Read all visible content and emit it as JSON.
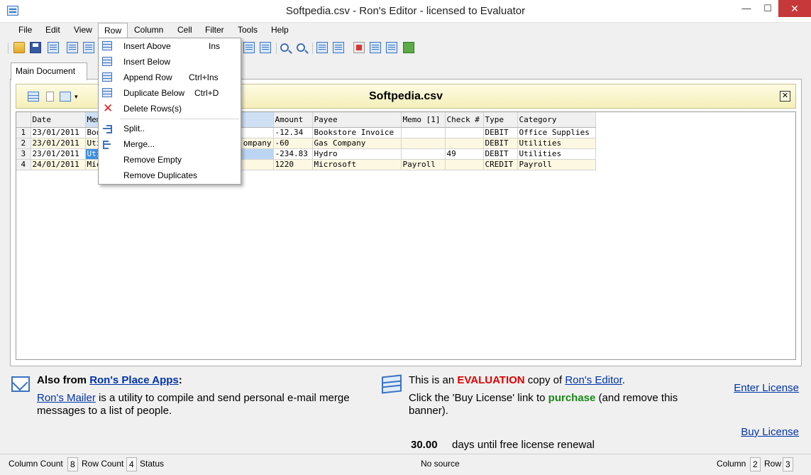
{
  "window": {
    "title": "Softpedia.csv - Ron's Editor - licensed to Evaluator",
    "minimize": "—",
    "maximize": "☐",
    "close": "✕"
  },
  "menubar": [
    "File",
    "Edit",
    "View",
    "Row",
    "Column",
    "Cell",
    "Filter",
    "Tools",
    "Help"
  ],
  "menu_open": "Row",
  "row_menu": [
    {
      "label": "Insert Above",
      "shortcut": "Ins",
      "icon": "insert-above-icon"
    },
    {
      "label": "Insert Below",
      "shortcut": "",
      "icon": "insert-below-icon"
    },
    {
      "label": "Append Row",
      "shortcut": "Ctrl+Ins",
      "icon": "append-row-icon"
    },
    {
      "label": "Duplicate Below",
      "shortcut": "Ctrl+D",
      "icon": "duplicate-icon"
    },
    {
      "label": "Delete Rows(s)",
      "shortcut": "",
      "icon": "delete-icon"
    },
    {
      "label": "Split..",
      "shortcut": "",
      "icon": "split-icon"
    },
    {
      "label": "Merge...",
      "shortcut": "",
      "icon": "merge-icon"
    },
    {
      "label": "Remove Empty",
      "shortcut": "",
      "icon": ""
    },
    {
      "label": "Remove Duplicates",
      "shortcut": "",
      "icon": ""
    }
  ],
  "tab": {
    "label": "Main Document"
  },
  "document": {
    "title": "Softpedia.csv",
    "close": "✕"
  },
  "grid": {
    "columns": [
      "Date",
      "Memo",
      "",
      "Amount",
      "Payee",
      "Memo [1]",
      "Check #",
      "Type",
      "Category"
    ],
    "rows": [
      {
        "n": "1",
        "cells": [
          "23/01/2011",
          "Boo",
          "",
          "-12.34",
          "Bookstore Invoice",
          "",
          "",
          "DEBIT",
          "Office Supplies"
        ]
      },
      {
        "n": "2",
        "cells": [
          "23/01/2011",
          "Uti",
          "ompany",
          "-60",
          "Gas Company",
          "",
          "",
          "DEBIT",
          "Utilities"
        ]
      },
      {
        "n": "3",
        "cells": [
          "23/01/2011",
          "Uti",
          "",
          "-234.83",
          "Hydro",
          "",
          "49",
          "DEBIT",
          "Utilities"
        ]
      },
      {
        "n": "4",
        "cells": [
          "24/01/2011",
          "Mic",
          "",
          "1220",
          "Microsoft",
          "Payroll",
          "",
          "CREDIT",
          "Payroll"
        ]
      }
    ]
  },
  "banner": {
    "also_from": "Also from ",
    "apps_link": "Ron's Place Apps",
    "colon": ":",
    "mailer_link": "Ron's Mailer",
    "mailer_desc": " is a utility to compile and send personal e-mail merge messages to a list of people.",
    "eval_pre": "This is an ",
    "eval_word": "EVALUATION",
    "eval_mid": " copy of ",
    "eval_link": "Ron's Editor",
    "eval_end": ".",
    "click_pre": "Click the 'Buy License' link to ",
    "click_word": "purchase",
    "click_end": " (and remove this banner).",
    "enter_license": "Enter License",
    "buy_license": "Buy License",
    "days_value": "30.00",
    "days_label": "days until free license renewal"
  },
  "status": {
    "column_count_label": "Column Count",
    "column_count": "8",
    "row_count_label": "Row Count",
    "row_count": "4",
    "status_label": "Status",
    "source": "No source",
    "column_label": "Column",
    "column": "2",
    "row_label": "Row",
    "row": "3"
  }
}
